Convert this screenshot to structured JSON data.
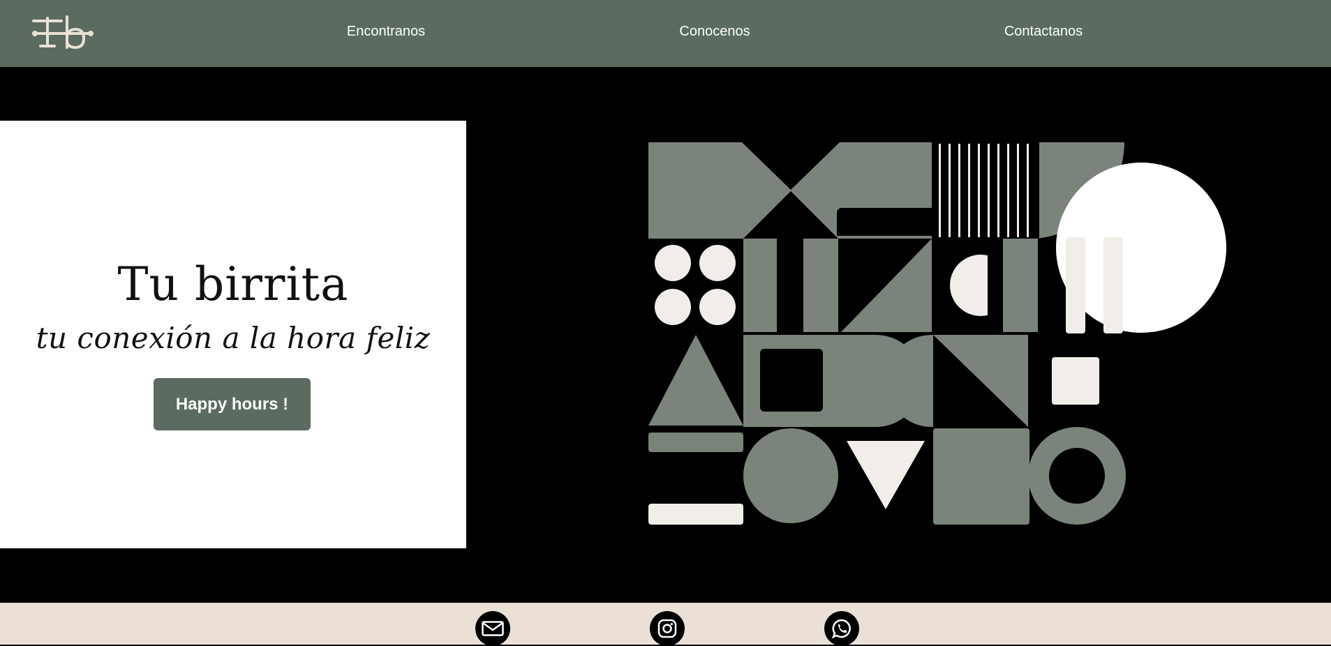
{
  "header": {
    "logo_text": "Tb",
    "nav": [
      {
        "label": "Encontranos"
      },
      {
        "label": "Conocenos"
      },
      {
        "label": "Contactanos"
      }
    ]
  },
  "hero": {
    "title": "Tu birrita",
    "tagline": "tu conexión a la hora feliz",
    "cta_label": "Happy hours !"
  },
  "footer": {
    "social": [
      {
        "icon": "mail-icon"
      },
      {
        "icon": "instagram-icon"
      },
      {
        "icon": "whatsapp-icon"
      }
    ]
  },
  "colors": {
    "header_bg": "#5b6b60",
    "art_green": "#7a847a",
    "cream": "#f1ede8",
    "footer_bg": "#eae0d5"
  }
}
